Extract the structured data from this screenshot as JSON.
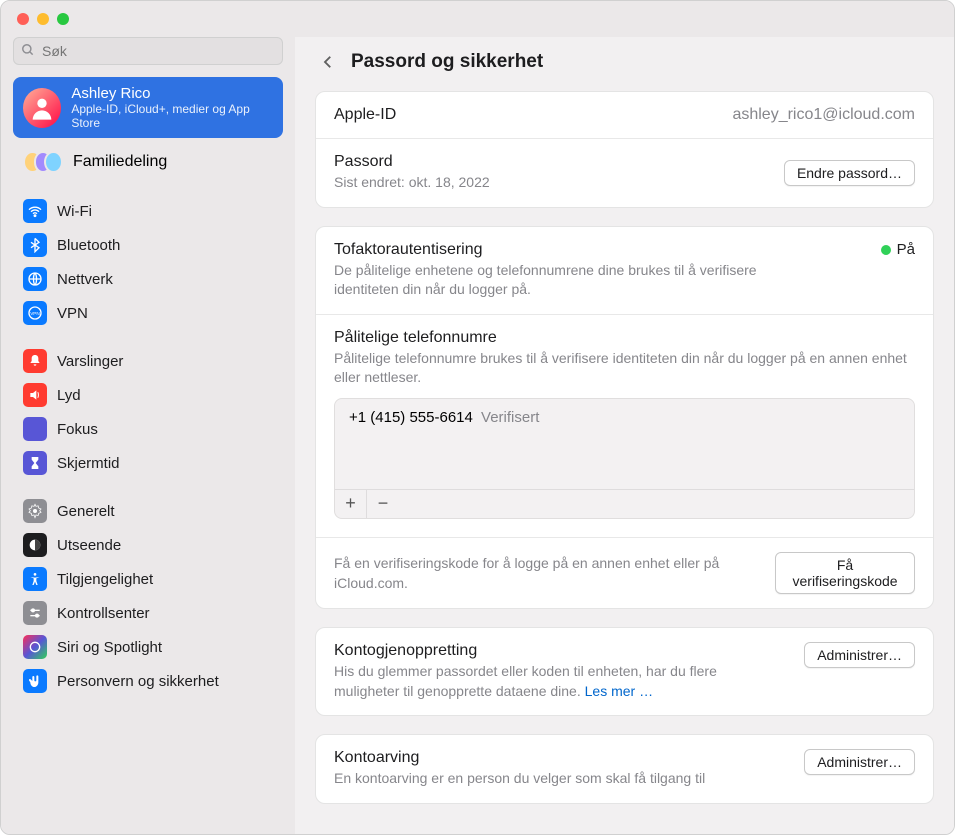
{
  "search": {
    "placeholder": "Søk"
  },
  "account": {
    "name": "Ashley Rico",
    "subtitle": "Apple-ID, iCloud+, medier og App Store"
  },
  "family": {
    "label": "Familiedeling"
  },
  "sidebar": {
    "items": [
      {
        "id": "wifi",
        "label": "Wi-Fi",
        "color": "#0a7aff"
      },
      {
        "id": "bluetooth",
        "label": "Bluetooth",
        "color": "#0a7aff"
      },
      {
        "id": "network",
        "label": "Nettverk",
        "color": "#0a7aff"
      },
      {
        "id": "vpn",
        "label": "VPN",
        "color": "#0a7aff"
      },
      {
        "id": "notifications",
        "label": "Varslinger",
        "color": "#ff3b30"
      },
      {
        "id": "sound",
        "label": "Lyd",
        "color": "#ff3b30"
      },
      {
        "id": "focus",
        "label": "Fokus",
        "color": "#5856d6"
      },
      {
        "id": "screentime",
        "label": "Skjermtid",
        "color": "#5856d6"
      },
      {
        "id": "general",
        "label": "Generelt",
        "color": "#8e8e93"
      },
      {
        "id": "appearance",
        "label": "Utseende",
        "color": "#1d1d1f"
      },
      {
        "id": "accessibility",
        "label": "Tilgjengelighet",
        "color": "#0a7aff"
      },
      {
        "id": "controlcenter",
        "label": "Kontrollsenter",
        "color": "#8e8e93"
      },
      {
        "id": "siri",
        "label": "Siri og Spotlight",
        "color": "linear"
      },
      {
        "id": "privacy",
        "label": "Personvern og sikkerhet",
        "color": "#0a7aff"
      }
    ]
  },
  "header": {
    "title": "Passord og sikkerhet"
  },
  "appleid": {
    "label": "Apple-ID",
    "value": "ashley_rico1@icloud.com"
  },
  "password": {
    "label": "Passord",
    "lastChanged": "Sist endret: okt. 18, 2022",
    "button": "Endre passord…"
  },
  "twofa": {
    "label": "Tofaktorautentisering",
    "status": "På",
    "desc": "De pålitelige enhetene og telefonnumrene dine brukes til å verifisere identiteten din når du logger på."
  },
  "trusted": {
    "label": "Pålitelige telefonnumre",
    "desc": "Pålitelige telefonnumre brukes til å verifisere identiteten din når du logger på en annen enhet eller nettleser.",
    "number": "+1 (415) 555-6614",
    "verified": "Verifisert",
    "add": "+",
    "remove": "−"
  },
  "verification": {
    "desc": "Få en verifiseringskode for å logge på en annen enhet eller på iCloud.com.",
    "button": "Få verifiseringskode"
  },
  "recovery": {
    "label": "Kontogjenoppretting",
    "desc": "His du glemmer passordet eller koden til enheten, har du flere muligheter til genopprette dataene dine. ",
    "link": "Les mer …",
    "button": "Administrer…"
  },
  "legacy": {
    "label": "Kontoarving",
    "desc": "En kontoarving er en person du velger som skal få tilgang til",
    "button": "Administrer…"
  }
}
